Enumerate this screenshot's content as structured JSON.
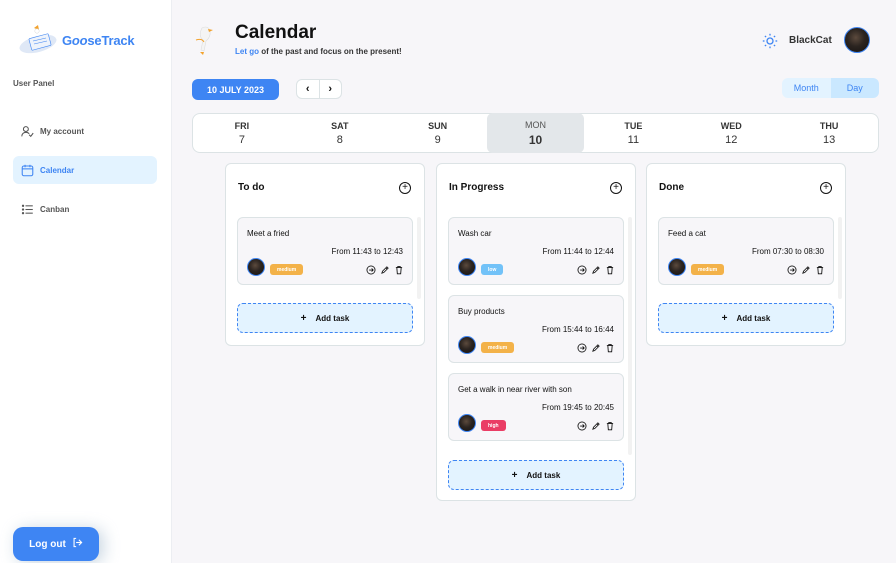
{
  "app": {
    "logo_text": "GooseTrack",
    "logo_accent": "oo",
    "logo_color": "#3e85f3"
  },
  "sidebar": {
    "panel_title": "User Panel",
    "items": [
      {
        "label": "My account",
        "icon": "user-check-icon"
      },
      {
        "label": "Calendar",
        "icon": "calendar-icon",
        "active": true
      },
      {
        "label": "Canban",
        "icon": "list-icon"
      }
    ],
    "logout_label": "Log out"
  },
  "header": {
    "title": "Calendar",
    "subtitle_accent": "Let go",
    "subtitle_rest": " of the past and focus on the present!",
    "username": "BlackCat",
    "theme_icon": "sun-icon"
  },
  "toolbar": {
    "date_label": "10 JULY 2023",
    "prev": "‹",
    "next": "›",
    "period_month": "Month",
    "period_day": "Day"
  },
  "week": [
    {
      "name": "FRI",
      "date": "7"
    },
    {
      "name": "SAT",
      "date": "8"
    },
    {
      "name": "SUN",
      "date": "9"
    },
    {
      "name": "MON",
      "date": "10",
      "active": true
    },
    {
      "name": "TUE",
      "date": "11"
    },
    {
      "name": "WED",
      "date": "12"
    },
    {
      "name": "THU",
      "date": "13"
    }
  ],
  "columns": [
    {
      "title": "To do",
      "add_label": "Add task",
      "tasks": [
        {
          "title": "Meet a fried",
          "time": "From 11:43 to 12:43",
          "priority": "medium"
        }
      ]
    },
    {
      "title": "In Progress",
      "add_label": "Add task",
      "tasks": [
        {
          "title": "Wash car",
          "time": "From 11:44 to 12:44",
          "priority": "low"
        },
        {
          "title": "Buy products",
          "time": "From 15:44 to 16:44",
          "priority": "medium"
        },
        {
          "title": "Get a walk in near river with son",
          "time": "From 19:45 to 20:45",
          "priority": "high"
        }
      ]
    },
    {
      "title": "Done",
      "add_label": "Add task",
      "tasks": [
        {
          "title": "Feed a cat",
          "time": "From 07:30 to 08:30",
          "priority": "medium"
        }
      ]
    }
  ],
  "priority_colors": {
    "low": "#72c2f8",
    "medium": "#f3b249",
    "high": "#ea3d65"
  }
}
